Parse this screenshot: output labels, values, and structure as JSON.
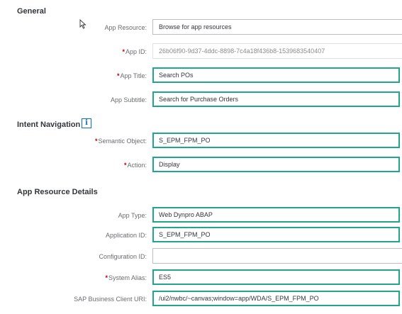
{
  "sections": {
    "general": "General",
    "intent": "Intent Navigation",
    "details": "App Resource Details"
  },
  "fields": {
    "app_resource": {
      "label": "App Resource:",
      "value": "Browse for app resources"
    },
    "app_id": {
      "label": "App ID:",
      "value": "26b06f90-9d37-4ddc-8898-7c4a18f436b8-1539683540407"
    },
    "app_title": {
      "label": "App Title:",
      "value": "Search POs"
    },
    "app_subtitle": {
      "label": "App Subtitle:",
      "value": "Search for Purchase Orders"
    },
    "semantic_object": {
      "label": "Semantic Object:",
      "value": "S_EPM_FPM_PO"
    },
    "action": {
      "label": "Action:",
      "value": "Display"
    },
    "app_type": {
      "label": "App Type:",
      "value": "Web Dynpro ABAP"
    },
    "application_id": {
      "label": "Application ID:",
      "value": "S_EPM_FPM_PO"
    },
    "configuration_id": {
      "label": "Configuration ID:",
      "value": ""
    },
    "system_alias": {
      "label": "System Alias:",
      "value": "ES5"
    },
    "sap_business_client_uri": {
      "label": "SAP Business Client URI:",
      "value": "/ui2/nwbc/~canvas;window=app/WDA/S_EPM_FPM_PO"
    }
  },
  "required_marker": "*",
  "icons": {
    "info": "info-icon",
    "cursor": "mouse-cursor-icon"
  },
  "colors": {
    "highlight": "#21a58c",
    "required": "#bb0000",
    "info": "#0a6ed1"
  }
}
